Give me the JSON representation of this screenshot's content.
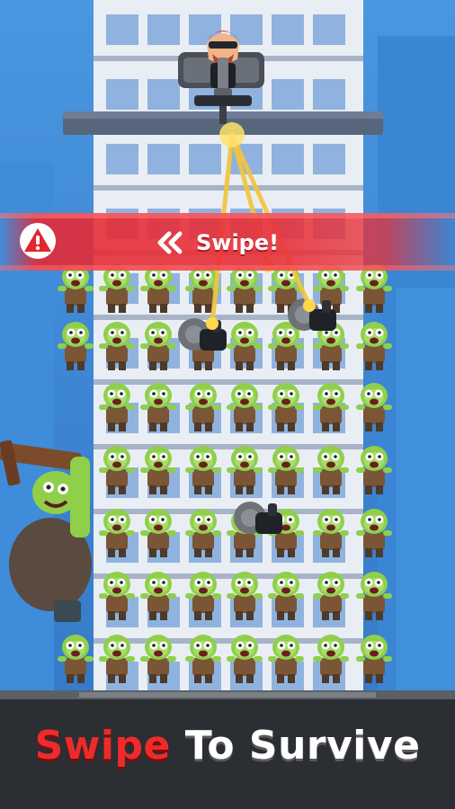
{
  "swipe_prompt": {
    "label": "Swipe!",
    "arrow_icon": "double-chevron-left",
    "warning_icon": "warning-triangle-icon"
  },
  "caption": {
    "word1": "Swipe",
    "word2": "To Survive",
    "word1_color": "#ee2b2b",
    "word2_color": "#ffffff"
  },
  "colors": {
    "sky": "#3d8ad8",
    "tower": "#e9edf4",
    "zombie_skin": "#8fcf4a",
    "zombie_shirt": "#7a5536",
    "band": "#e8303a",
    "street": "#2b2e33"
  }
}
